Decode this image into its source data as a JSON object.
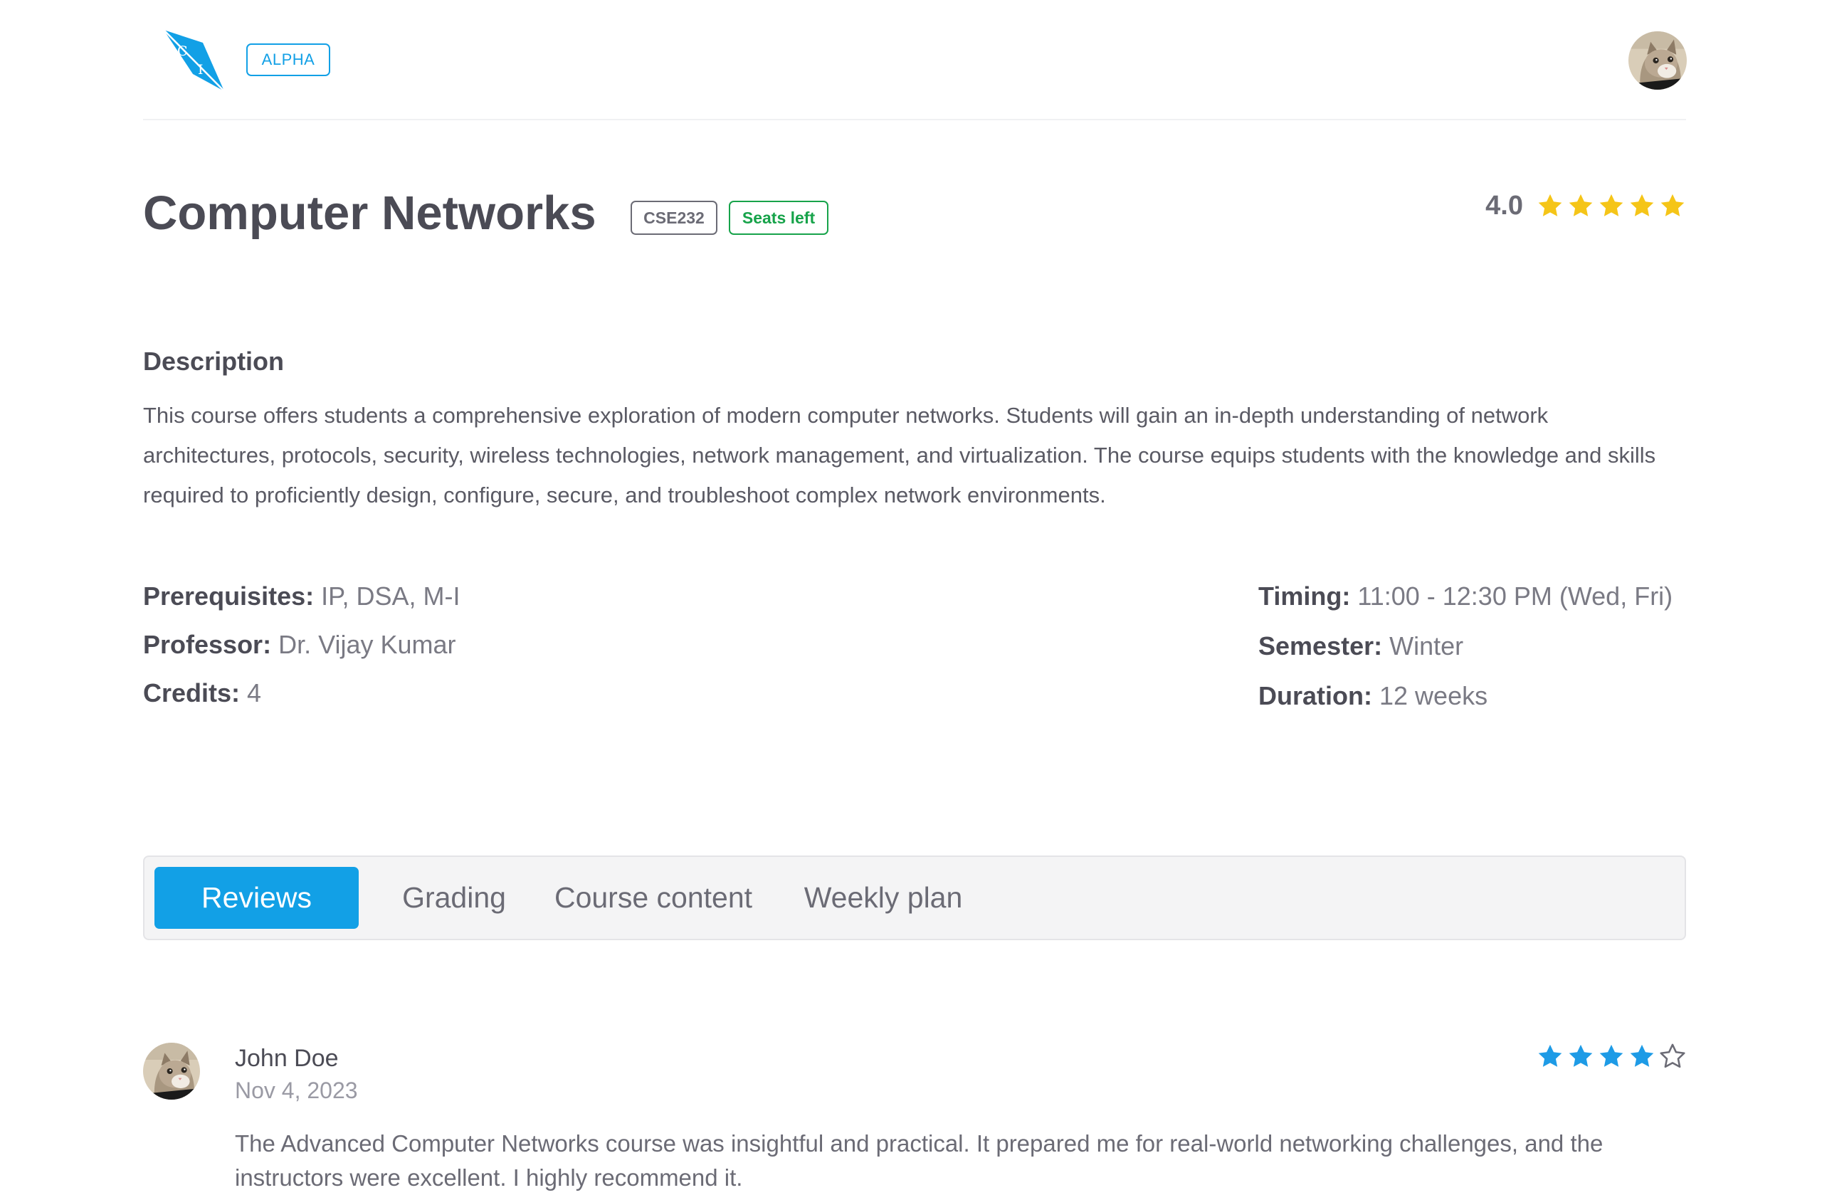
{
  "header": {
    "logo_letters": [
      "C",
      "I"
    ],
    "badge": "ALPHA",
    "brand_color": "#12a0e6"
  },
  "course": {
    "title": "Computer Networks",
    "code": "CSE232",
    "availability": "Seats left",
    "rating": "4.0",
    "rating_stars_filled": 5,
    "star_color": "#f5c518",
    "description_heading": "Description",
    "description": "This course offers students a comprehensive exploration of modern computer networks. Students will gain an in-depth understanding of network architectures, protocols, security, wireless technologies, network management, and virtualization. The course equips students with the knowledge and skills required to proficiently design, configure, secure, and troubleshoot complex network environments.",
    "info_left": [
      {
        "label": "Prerequisites:",
        "value": "IP, DSA, M-I"
      },
      {
        "label": "Professor:",
        "value": "Dr. Vijay Kumar"
      },
      {
        "label": "Credits:",
        "value": "4"
      }
    ],
    "info_right": [
      {
        "label": "Timing:",
        "value": "11:00 - 12:30 PM (Wed, Fri)"
      },
      {
        "label": "Semester:",
        "value": "Winter"
      },
      {
        "label": "Duration:",
        "value": "12 weeks"
      }
    ]
  },
  "tabs": [
    {
      "label": "Reviews",
      "active": true
    },
    {
      "label": "Grading",
      "active": false
    },
    {
      "label": "Course content",
      "active": false
    },
    {
      "label": "Weekly plan",
      "active": false
    }
  ],
  "reviews": [
    {
      "name": "John Doe",
      "date": "Nov 4, 2023",
      "rating": 4,
      "max_rating": 5,
      "star_color": "#1e9be6",
      "text": "The Advanced Computer Networks course was insightful and practical. It prepared me for real-world networking challenges, and the instructors were excellent. I highly recommend it."
    }
  ]
}
